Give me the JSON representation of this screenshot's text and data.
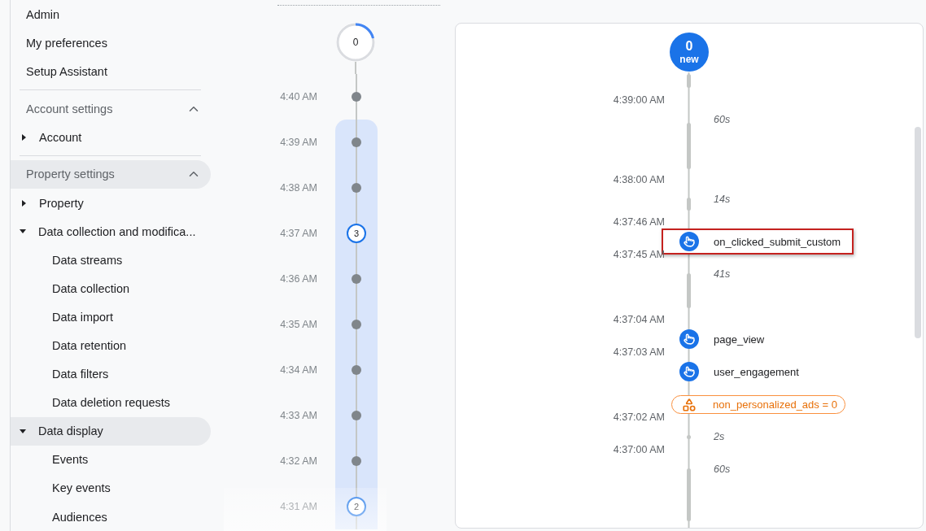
{
  "sidebar": {
    "top_links": [
      {
        "label": "Admin"
      },
      {
        "label": "My preferences"
      },
      {
        "label": "Setup Assistant"
      }
    ],
    "sections": [
      {
        "title": "Account settings",
        "expanded": true,
        "selected": false,
        "items": [
          {
            "label": "Account",
            "expanded": false,
            "selected": false
          }
        ]
      },
      {
        "title": "Property settings",
        "expanded": true,
        "selected": true,
        "items": [
          {
            "label": "Property",
            "expanded": false,
            "selected": false
          },
          {
            "label": "Data collection and modifica...",
            "expanded": true,
            "selected": false,
            "children": [
              {
                "label": "Data streams"
              },
              {
                "label": "Data collection"
              },
              {
                "label": "Data import"
              },
              {
                "label": "Data retention"
              },
              {
                "label": "Data filters"
              },
              {
                "label": "Data deletion requests"
              }
            ]
          },
          {
            "label": "Data display",
            "expanded": true,
            "selected": true,
            "children": [
              {
                "label": "Events"
              },
              {
                "label": "Key events"
              },
              {
                "label": "Audiences"
              }
            ]
          }
        ]
      }
    ]
  },
  "minute_timeline": {
    "top_count": "0",
    "rows": [
      {
        "time": "4:40 AM",
        "kind": "dot",
        "in_range": false
      },
      {
        "time": "4:39 AM",
        "kind": "dot",
        "in_range": true
      },
      {
        "time": "4:38 AM",
        "kind": "dot",
        "in_range": true
      },
      {
        "time": "4:37 AM",
        "kind": "count",
        "count": "3",
        "in_range": true
      },
      {
        "time": "4:36 AM",
        "kind": "dot",
        "in_range": true
      },
      {
        "time": "4:35 AM",
        "kind": "dot",
        "in_range": true
      },
      {
        "time": "4:34 AM",
        "kind": "dot",
        "in_range": true
      },
      {
        "time": "4:33 AM",
        "kind": "dot",
        "in_range": true
      },
      {
        "time": "4:32 AM",
        "kind": "dot",
        "in_range": true
      },
      {
        "time": "4:31 AM",
        "kind": "count",
        "count": "2",
        "in_range": true
      }
    ]
  },
  "event_stream": {
    "header": {
      "count": "0",
      "label": "new"
    },
    "entries": [
      {
        "kind": "time",
        "text": "4:39:00 AM"
      },
      {
        "kind": "gap",
        "text": "60s"
      },
      {
        "kind": "time",
        "text": "4:38:00 AM"
      },
      {
        "kind": "gap",
        "text": "14s"
      },
      {
        "kind": "time",
        "text": "4:37:46 AM"
      },
      {
        "kind": "event",
        "text": "on_clicked_submit_custom",
        "highlighted": true
      },
      {
        "kind": "time",
        "text": "4:37:45 AM"
      },
      {
        "kind": "gap",
        "text": "41s"
      },
      {
        "kind": "time",
        "text": "4:37:04 AM"
      },
      {
        "kind": "event",
        "text": "page_view",
        "highlighted": false
      },
      {
        "kind": "time",
        "text": "4:37:03 AM"
      },
      {
        "kind": "event",
        "text": "user_engagement",
        "highlighted": false
      },
      {
        "kind": "param",
        "text": "non_personalized_ads = 0"
      },
      {
        "kind": "time",
        "text": "4:37:02 AM"
      },
      {
        "kind": "gap",
        "text": "2s"
      },
      {
        "kind": "time",
        "text": "4:37:00 AM"
      },
      {
        "kind": "gap",
        "text": "60s"
      }
    ]
  }
}
